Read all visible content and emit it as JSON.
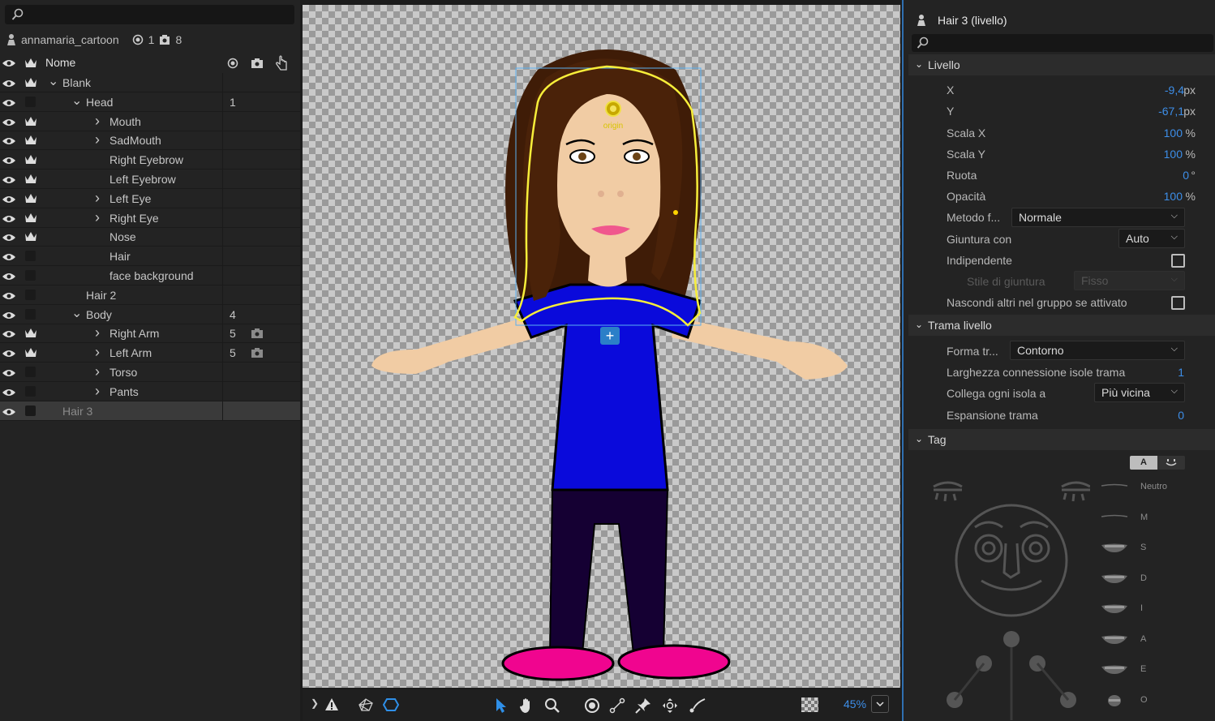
{
  "layers_panel": {
    "search_placeholder": "",
    "project_name": "annamaria_cartoon",
    "project_count_1": "1",
    "project_count_2": "8",
    "header_name": "Nome",
    "rows": [
      {
        "name": "Blank",
        "level": 1,
        "expand": "open",
        "crown": true,
        "num": ""
      },
      {
        "name": "Head",
        "level": 2,
        "expand": "open",
        "crown": false,
        "num": "1"
      },
      {
        "name": "Mouth",
        "level": 3,
        "expand": "closed",
        "crown": true,
        "num": ""
      },
      {
        "name": "SadMouth",
        "level": 3,
        "expand": "closed",
        "crown": true,
        "num": ""
      },
      {
        "name": "Right Eyebrow",
        "level": 3,
        "expand": "none",
        "crown": true,
        "num": ""
      },
      {
        "name": "Left Eyebrow",
        "level": 3,
        "expand": "none",
        "crown": true,
        "num": ""
      },
      {
        "name": "Left Eye",
        "level": 3,
        "expand": "closed",
        "crown": true,
        "num": ""
      },
      {
        "name": "Right Eye",
        "level": 3,
        "expand": "closed",
        "crown": true,
        "num": ""
      },
      {
        "name": "Nose",
        "level": 3,
        "expand": "none",
        "crown": true,
        "num": ""
      },
      {
        "name": "Hair",
        "level": 3,
        "expand": "none",
        "crown": false,
        "num": ""
      },
      {
        "name": "face background",
        "level": 3,
        "expand": "none",
        "crown": false,
        "num": ""
      },
      {
        "name": "Hair 2",
        "level": 2,
        "expand": "none",
        "crown": false,
        "num": ""
      },
      {
        "name": "Body",
        "level": 2,
        "expand": "open",
        "crown": false,
        "num": "4"
      },
      {
        "name": "Right Arm",
        "level": 3,
        "expand": "closed",
        "crown": true,
        "num": "5"
      },
      {
        "name": "Left Arm",
        "level": 3,
        "expand": "closed",
        "crown": true,
        "num": "5"
      },
      {
        "name": "Torso",
        "level": 3,
        "expand": "closed",
        "crown": false,
        "num": ""
      },
      {
        "name": "Pants",
        "level": 3,
        "expand": "closed",
        "crown": false,
        "num": ""
      },
      {
        "name": "Hair 3",
        "level": 1,
        "expand": "none",
        "crown": false,
        "num": "",
        "selected": true
      }
    ]
  },
  "stage": {
    "origin_label": "origin",
    "zoom": "45%"
  },
  "properties": {
    "title": "Hair 3 (livello)",
    "section_livello": "Livello",
    "x_label": "X",
    "x_value": "-9,4",
    "x_unit": "px",
    "y_label": "Y",
    "y_value": "-67,1",
    "y_unit": "px",
    "scalex_label": "Scala X",
    "scalex_value": "100",
    "scalex_unit": "%",
    "scaley_label": "Scala Y",
    "scaley_value": "100",
    "scaley_unit": "%",
    "ruota_label": "Ruota",
    "ruota_value": "0",
    "ruota_unit": "°",
    "opacita_label": "Opacità",
    "opacita_value": "100",
    "opacita_unit": "%",
    "metodo_label": "Metodo f...",
    "metodo_value": "Normale",
    "giuntura_label": "Giuntura con",
    "giuntura_value": "Auto",
    "indipendente_label": "Indipendente",
    "stile_label": "Stile di giuntura",
    "stile_value": "Fisso",
    "nascondi_label": "Nascondi altri nel gruppo se attivato",
    "section_trama": "Trama livello",
    "forma_label": "Forma tr...",
    "forma_value": "Contorno",
    "larghezza_label": "Larghezza connessione isole trama",
    "larghezza_value": "1",
    "collega_label": "Collega ogni isola a",
    "collega_value": "Più vicina",
    "espansione_label": "Espansione trama",
    "espansione_value": "0",
    "section_tag": "Tag",
    "tag_btn_a": "A",
    "visemes": [
      "Neutro",
      "M",
      "S",
      "D",
      "I",
      "A",
      "E",
      "O"
    ]
  }
}
